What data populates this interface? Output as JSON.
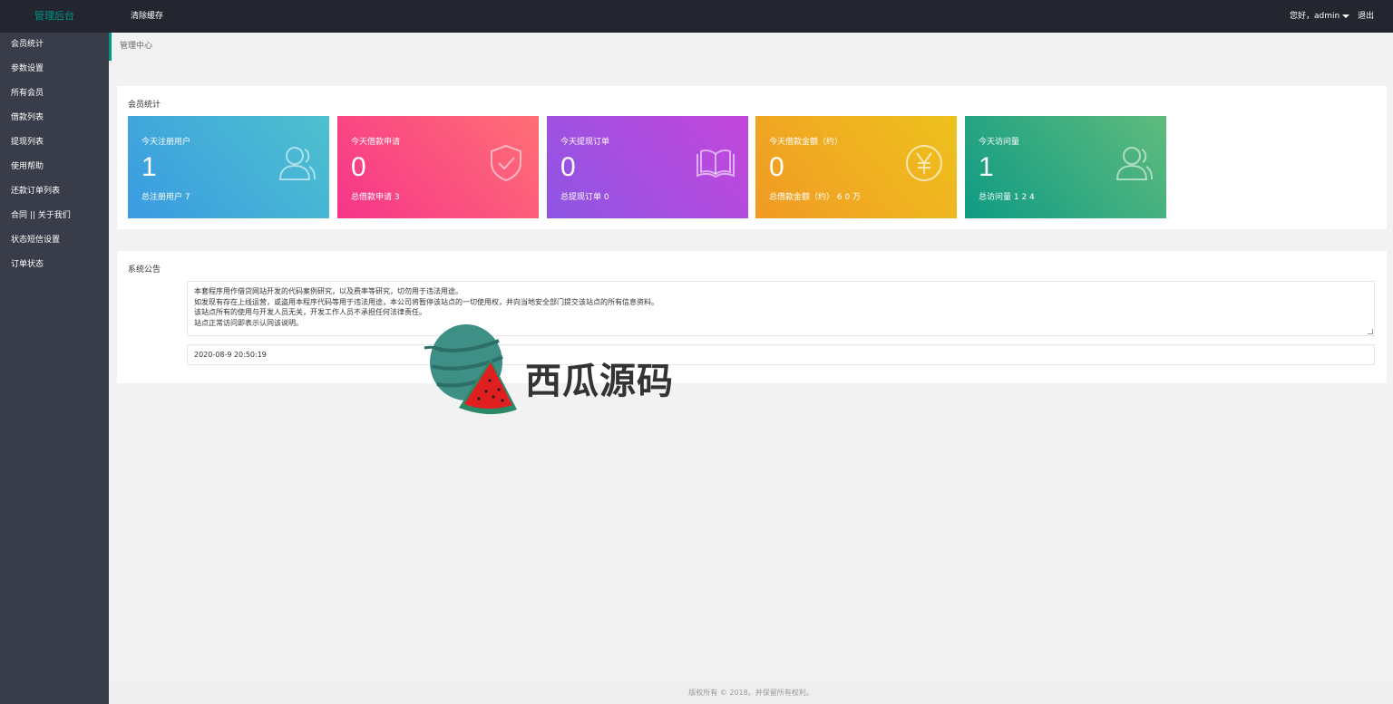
{
  "header": {
    "logo": "管理后台",
    "clear_cache": "清除缓存",
    "greeting": "您好，admin",
    "logout": "退出"
  },
  "sidebar": {
    "items": [
      {
        "label": "会员统计"
      },
      {
        "label": "参数设置"
      },
      {
        "label": "所有会员"
      },
      {
        "label": "借款列表"
      },
      {
        "label": "提现列表"
      },
      {
        "label": "使用帮助"
      },
      {
        "label": "还款订单列表"
      },
      {
        "label": "合同 || 关于我们"
      },
      {
        "label": "状态短信设置"
      },
      {
        "label": "订单状态"
      }
    ]
  },
  "breadcrumb": "管理中心",
  "stats": {
    "title": "会员统计",
    "cards": [
      {
        "title": "今天注册用户",
        "value": "1",
        "total": "总注册用户 7",
        "icon": "user-icon"
      },
      {
        "title": "今天借款申请",
        "value": "0",
        "total": "总借款申请 3",
        "icon": "shield-check-icon"
      },
      {
        "title": "今天提现订单",
        "value": "0",
        "total": "总提现订单 0",
        "icon": "book-icon"
      },
      {
        "title": "今天借款金额（约）",
        "value": "0",
        "total": "总借款金额（约） 6 0 万",
        "icon": "yen-icon"
      },
      {
        "title": "今天访问量",
        "value": "1",
        "total": "总访问量 1 2 4",
        "icon": "user-icon"
      }
    ]
  },
  "notice": {
    "title": "系统公告",
    "lines": [
      "本套程序用作借贷网站开发的代码案例研究，以及费率等研究，切勿用于违法用途。",
      "如发现有存在上线运营，或盗用本程序代码等用于违法用途，本公司将暂停该站点的一切使用权，并向当地安全部门提交该站点的所有信息资料。",
      "该站点所有的使用与开发人员无关，开发工作人员不承担任何法律责任。",
      "站点正常访问即表示认同该说明。"
    ],
    "date": "2020-08-9 20:50:19"
  },
  "watermark": "西瓜源码",
  "footer": "版权所有 © 2018。并保留所有权利。",
  "colors": {
    "topbar": "#23262e",
    "sidebar": "#393d49",
    "accent": "#009688"
  }
}
